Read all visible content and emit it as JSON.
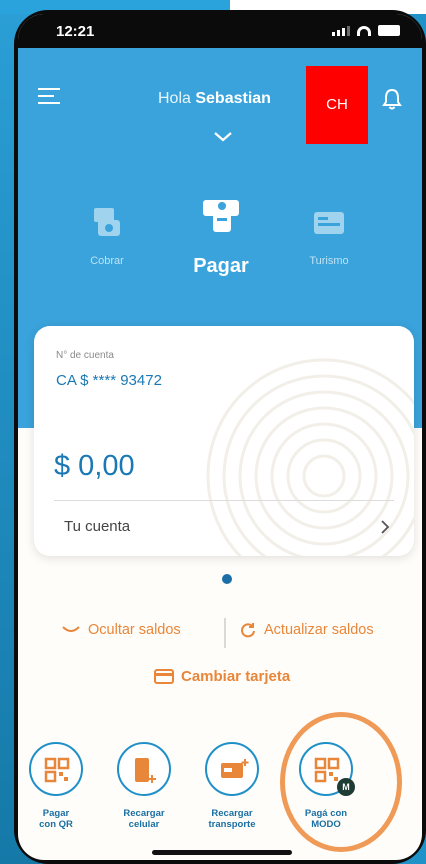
{
  "status_bar": {
    "time": "12:21"
  },
  "header": {
    "greeting": "Hola",
    "user_name": "Sebastian",
    "ch_button": "CH"
  },
  "actions": [
    {
      "label": "Cobrar",
      "icon": "cobrar-icon"
    },
    {
      "label": "Pagar",
      "icon": "pagar-icon",
      "active": true
    },
    {
      "label": "Turismo",
      "icon": "turismo-icon"
    }
  ],
  "account_card": {
    "account_label": "N° de cuenta",
    "account_number": "CA $ **** 93472",
    "balance": "$ 0,00",
    "link_label": "Tu cuenta"
  },
  "links": {
    "hide_balances": "Ocultar saldos",
    "refresh_balances": "Actualizar saldos",
    "change_card": "Cambiar tarjeta"
  },
  "quick_actions": [
    {
      "label_line1": "Pagar",
      "label_line2": "con QR",
      "icon": "qr-icon"
    },
    {
      "label_line1": "Recargar",
      "label_line2": "celular",
      "icon": "phone-recharge-icon"
    },
    {
      "label_line1": "Recargar",
      "label_line2": "transporte",
      "icon": "transport-card-icon"
    },
    {
      "label_line1": "Pagá con",
      "label_line2": "MODO",
      "icon": "modo-qr-icon",
      "badge": "M"
    }
  ],
  "colors": {
    "header_blue": "#3aa3db",
    "accent_orange": "#e8863a",
    "text_blue": "#1a78b4",
    "highlight": "#f09a57",
    "ch_red": "#ff0000"
  }
}
